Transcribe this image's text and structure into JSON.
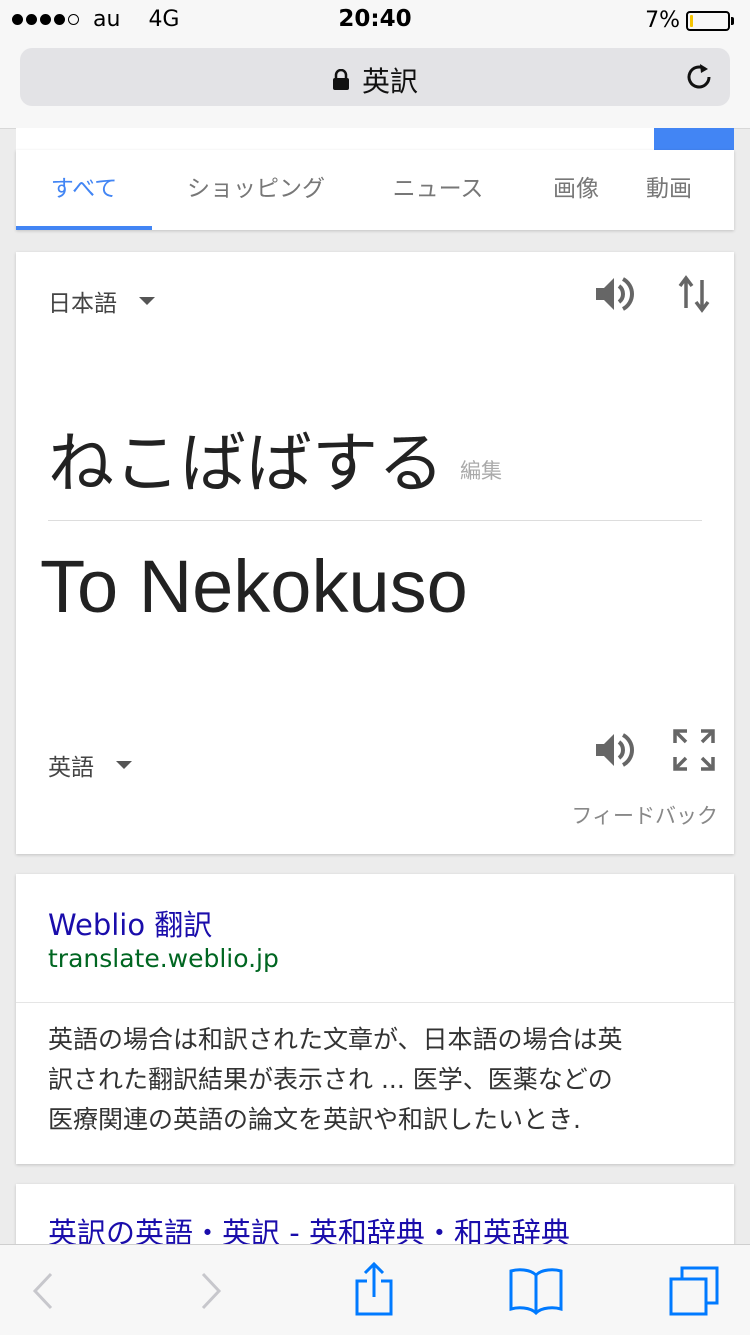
{
  "status_bar": {
    "carrier": "au",
    "network": "4G",
    "time": "20:40",
    "battery": "7%",
    "battery_level": 0.07,
    "signal_bars": 4
  },
  "browser": {
    "url": "英訳"
  },
  "search_tabs": [
    "すべて",
    "ショッピング",
    "ニュース",
    "画像",
    "動画"
  ],
  "translate": {
    "source_language": "日本語",
    "source_text": "ねこばばする",
    "edit_label": "編集",
    "translated_text": "To Nekokuso",
    "target_language": "英語",
    "feedback_label": "フィードバック"
  },
  "results": [
    {
      "title": "Weblio 翻訳",
      "url": "translate.weblio.jp",
      "snippet_lines": [
        "英語の場合は和訳された文章が、日本語の場合は英",
        "訳された翻訳結果が表示され ... 医学、医薬などの",
        "医療関連の英語の論文を英訳や和訳したいとき."
      ]
    },
    {
      "title": "英訳の英語・英訳 - 英和辞典・和英辞典"
    }
  ],
  "colors": {
    "accent": "#4285f4",
    "link": "#1a0dab",
    "url_green": "#006621",
    "ios_blue": "#007aff"
  }
}
